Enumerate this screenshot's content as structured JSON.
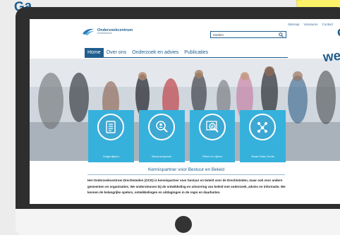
{
  "header": {
    "util_links": [
      "Sitemap",
      "Vacatures",
      "Contact"
    ],
    "logo_title": "Onderzoekcentrum",
    "logo_sub": "Drechtsteden",
    "search_value": "Zoeken"
  },
  "nav": {
    "items": [
      "Home",
      "Over ons",
      "Onderzoek en advies",
      "Publicaties"
    ],
    "active": "Home"
  },
  "tiles": [
    {
      "label": "Vragenlijsten",
      "icon": "list-icon"
    },
    {
      "label": "Bewonerspanel",
      "icon": "magnifier-people-icon"
    },
    {
      "label": "Feiten en cijfers",
      "icon": "magnifier-chart-icon"
    },
    {
      "label": "Smart Data Center",
      "icon": "data-network-icon"
    }
  ],
  "content": {
    "heading": "Kennispartner voor Bestuur en Beleid",
    "paragraph": "Het Onderzoekcentrum Drechtsteden (OCD) is kennispartner voor bestuur en beleid voor de Drechtsteden, maar ook voor andere gemeenten en organisaties. We ondersteunen bij de ontwikkeling en uitvoering van beleid met onderzoek, advies en informatie. We kennen de belangrijke spelers, ontwikkelingen en uitdagingen in de regio en daarbuiten."
  },
  "banner": {
    "line1": "Ga",
    "line2": "c",
    "line3": "we"
  },
  "colors": {
    "brand": "#1e5d8e",
    "tile": "#36b1dc",
    "banner": "#fbf26a",
    "bezel": "#2e2e2e"
  }
}
